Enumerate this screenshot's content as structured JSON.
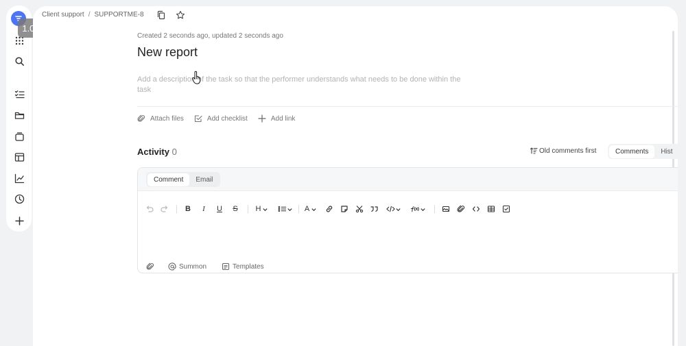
{
  "app": {
    "speed_badge": "1.00",
    "brand_color": "#4d74f2"
  },
  "sidebar": {
    "items": [
      {
        "icon": "logo-icon"
      },
      {
        "icon": "apps-grid-icon"
      },
      {
        "icon": "search-icon"
      },
      {
        "icon": "tasks-list-icon"
      },
      {
        "icon": "folder-icon"
      },
      {
        "icon": "queues-icon"
      },
      {
        "icon": "boards-icon"
      },
      {
        "icon": "dashboards-icon"
      },
      {
        "icon": "time-tracking-icon"
      },
      {
        "icon": "add-icon"
      }
    ]
  },
  "breadcrumb": {
    "parent": "Client support",
    "separator": "/",
    "current": "SUPPORTME-8"
  },
  "task": {
    "meta": "Created 2 seconds ago, updated 2 seconds ago",
    "title": "New report",
    "description_placeholder": "Add a description of the task so that the performer understands what needs to be done within the task"
  },
  "actions": {
    "attach_files": "Attach files",
    "add_checklist": "Add checklist",
    "add_link": "Add link"
  },
  "activity": {
    "label": "Activity",
    "count": "0",
    "sort_label": "Old comments first",
    "tabs": [
      "Comments",
      "Hist"
    ],
    "active_tab": "Comments"
  },
  "editor": {
    "mode_tabs": [
      "Comment",
      "Email"
    ],
    "active_mode": "Comment",
    "toolbar": {
      "bold": "B",
      "italic": "I",
      "underline": "U",
      "strike": "S",
      "heading": "H",
      "text_color": "A"
    },
    "footer": {
      "summon": "Summon",
      "templates": "Templates"
    }
  }
}
